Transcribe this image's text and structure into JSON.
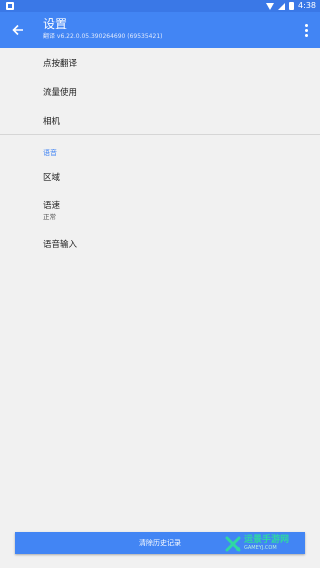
{
  "status_bar": {
    "time": "4:38",
    "icons": [
      "notification-icon",
      "wifi-icon",
      "signal-icon",
      "battery-icon"
    ]
  },
  "app_bar": {
    "title": "设置",
    "subtitle": "翻译 v6.22.0.05.390264690 (69535421)",
    "back_icon": "arrow-left-icon",
    "overflow_icon": "more-vert-icon"
  },
  "settings": {
    "items": [
      {
        "label": "点按翻译"
      },
      {
        "label": "流量使用"
      },
      {
        "label": "相机"
      }
    ],
    "voice_section": {
      "header": "语音",
      "items": [
        {
          "label": "区域"
        },
        {
          "label": "语速",
          "value": "正常"
        },
        {
          "label": "语音输入"
        }
      ]
    }
  },
  "footer": {
    "clear_history_label": "清除历史记录"
  },
  "watermark": {
    "main": "运景手游网",
    "sub": "GAMEYJ.COM"
  },
  "colors": {
    "status_bar": "#3a78e7",
    "app_bar": "#4285f4",
    "accent": "#4285f4",
    "background": "#f1f1f1"
  }
}
